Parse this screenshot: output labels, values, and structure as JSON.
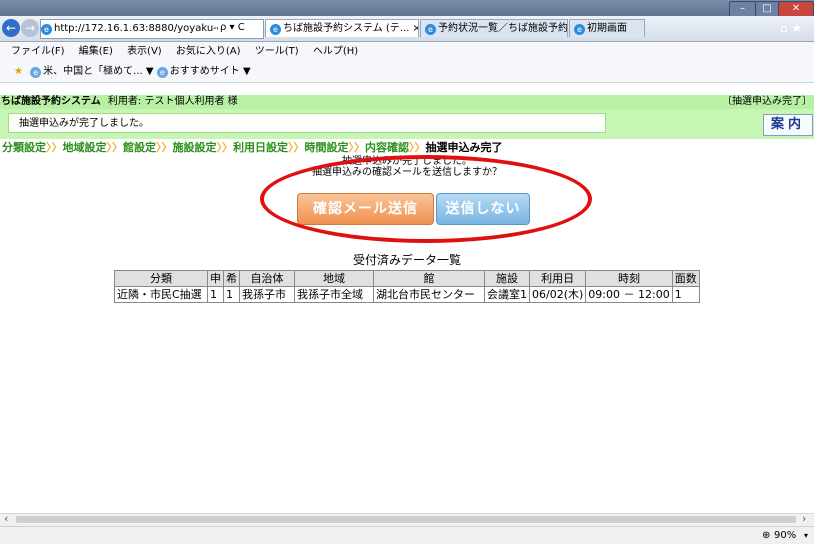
{
  "window": {
    "minimize": "–",
    "maximize": "□",
    "close": "✕"
  },
  "browser": {
    "address": "http://172.16.1.63:8880/yoyaku-ch",
    "address_icons": "ρ ▾ C",
    "tabs": [
      {
        "label": "ちば施設予約システム (テ...",
        "close": "×"
      },
      {
        "label": "予約状況一覧／ちば施設予約..."
      },
      {
        "label": "初期画面"
      }
    ],
    "home_star": "⌂ ★",
    "menu": [
      "ファイル(F)",
      "編集(E)",
      "表示(V)",
      "お気に入り(A)",
      "ツール(T)",
      "ヘルプ(H)"
    ],
    "favorites": [
      "米、中国と「極めて...",
      "おすすめサイト"
    ],
    "zoom": "90%"
  },
  "page": {
    "system_title": "ちば施設予約システム",
    "user_label": "利用者:",
    "user_name": "テスト個人利用者 様",
    "status_right": "〔抽選申込み完了〕",
    "message": "抽選申込みが完了しました。",
    "guide_button": "案内",
    "breadcrumbs": [
      "分類設定",
      "地域設定",
      "館設定",
      "施設設定",
      "利用日設定",
      "時間設定",
      "内容確認",
      "抽選申込み完了"
    ],
    "breadcrumb_sep": "〉〉",
    "notice_line1": "抽選申込みが完了しました。",
    "notice_line2": "抽選申込みの確認メールを送信しますか？",
    "send_button": "確認メール送信",
    "nosend_button": "送信しない",
    "table_caption": "受付済みデータ一覧",
    "table_headers": [
      "分類",
      "申",
      "希",
      "自治体",
      "地域",
      "館",
      "施設",
      "利用日",
      "時刻",
      "面数"
    ],
    "table_rows": [
      [
        "近隣・市民C抽選",
        "1",
        "1",
        "我孫子市",
        "我孫子市全域",
        "湖北台市民センター",
        "会議室1",
        "06/02(木)",
        "09:00 － 12:00",
        "1"
      ]
    ]
  },
  "colors": {
    "header_green": "#b8f0a4",
    "breadcrumb_green": "#2b8f1a",
    "send_orange": "#f4a66a",
    "nosend_blue": "#8fc2ea",
    "highlight_red": "#e01010"
  }
}
